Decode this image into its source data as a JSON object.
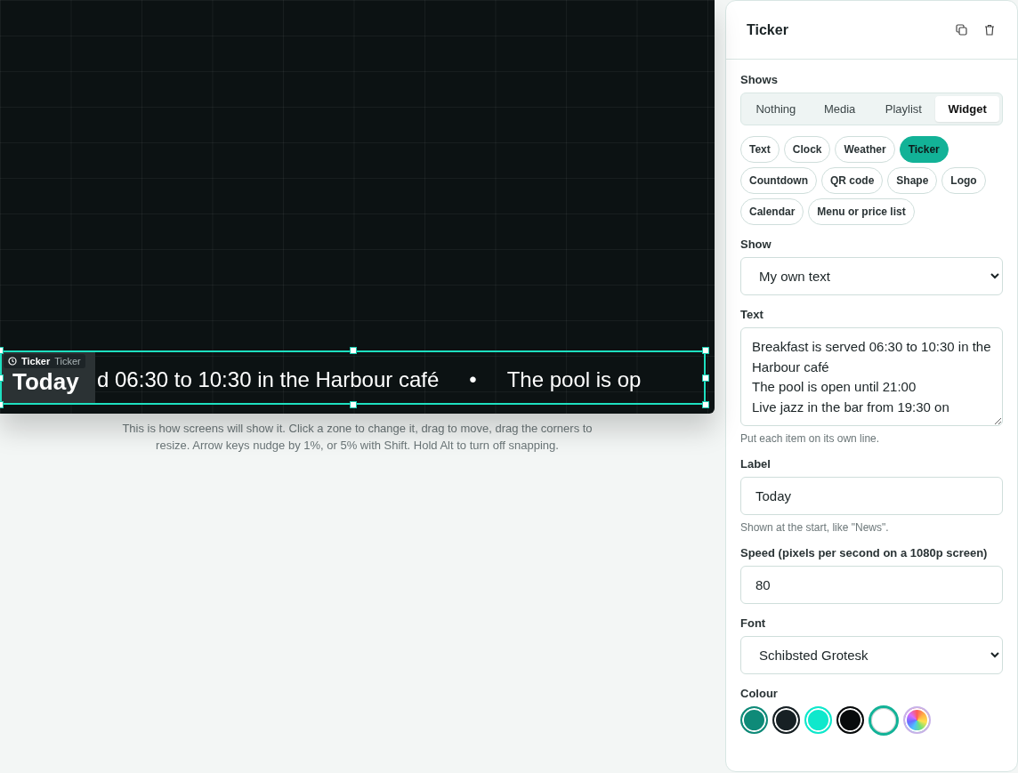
{
  "canvas": {
    "zone": {
      "tag_title": "Ticker",
      "tag_type": "Ticker",
      "label": "Today",
      "items": [
        "d 06:30 to 10:30 in the Harbour café",
        "The pool is op"
      ],
      "separator": "•",
      "selected": true
    }
  },
  "caption": "This is how screens will show it. Click a zone to change it, drag to move, drag the corners to resize. Arrow keys nudge by 1%, or 5% with Shift. Hold Alt to turn off snapping.",
  "panel": {
    "title": "Ticker",
    "shows": {
      "label": "Shows",
      "tabs": [
        {
          "label": "Nothing",
          "selected": false
        },
        {
          "label": "Media",
          "selected": false
        },
        {
          "label": "Playlist",
          "selected": false
        },
        {
          "label": "Widget",
          "selected": true
        }
      ]
    },
    "widgets": [
      {
        "label": "Text",
        "selected": false
      },
      {
        "label": "Clock",
        "selected": false
      },
      {
        "label": "Weather",
        "selected": false
      },
      {
        "label": "Ticker",
        "selected": true
      },
      {
        "label": "Countdown",
        "selected": false
      },
      {
        "label": "QR code",
        "selected": false
      },
      {
        "label": "Shape",
        "selected": false
      },
      {
        "label": "Logo",
        "selected": false
      },
      {
        "label": "Calendar",
        "selected": false
      },
      {
        "label": "Menu or price list",
        "selected": false
      }
    ],
    "fields": [
      {
        "kind": "select",
        "label": "Show",
        "value": "My own text"
      },
      {
        "kind": "textarea",
        "label": "Text",
        "value": "Breakfast is served 06:30 to 10:30 in the Harbour café\nThe pool is open until 21:00\nLive jazz in the bar from 19:30 on",
        "hint": "Put each item on its own line."
      },
      {
        "kind": "input",
        "label": "Label",
        "value": "Today",
        "hint": "Shown at the start, like \"News\"."
      },
      {
        "kind": "input",
        "label": "Speed (pixels per second on a 1080p screen)",
        "value": "80"
      },
      {
        "kind": "select",
        "label": "Font",
        "value": "Schibsted Grotesk"
      }
    ],
    "colour": {
      "label": "Colour",
      "swatches": [
        {
          "kind": "solid",
          "color": "#0e8a78",
          "selected": false
        },
        {
          "kind": "solid",
          "color": "#172024",
          "selected": false
        },
        {
          "kind": "solid",
          "color": "#0fe8cc",
          "selected": false
        },
        {
          "kind": "solid",
          "color": "#080b0c",
          "selected": false
        },
        {
          "kind": "solid",
          "color": "#ffffff",
          "selected": true
        },
        {
          "kind": "custom",
          "selected": false
        }
      ]
    }
  }
}
